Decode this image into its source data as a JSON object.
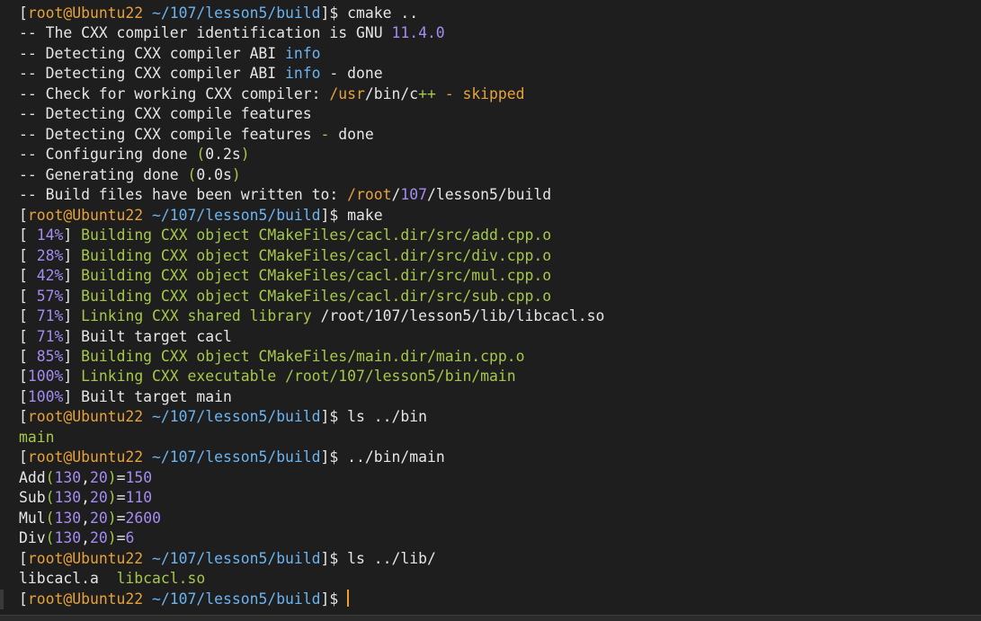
{
  "colors": {
    "background": "#1e1e1e",
    "default": "#e6e6e6",
    "orange": "#e8a23a",
    "purple": "#a58cf0",
    "blue": "#6cb4f0",
    "green": "#a6c84a",
    "bracket": "#e6e6e6"
  },
  "terminal": {
    "lines": [
      [
        [
          "[",
          "bracket"
        ],
        [
          "root@Ubuntu22",
          "orange"
        ],
        [
          " ~/107/lesson5/build",
          "blue"
        ],
        [
          "]$ cmake ..",
          "default"
        ]
      ],
      [
        [
          "-- The CXX compiler identification is GNU ",
          "default"
        ],
        [
          "11.4.0",
          "purple"
        ]
      ],
      [
        [
          "-- Detecting CXX compiler ABI ",
          "default"
        ],
        [
          "info",
          "blue"
        ]
      ],
      [
        [
          "-- Detecting CXX compiler ABI ",
          "default"
        ],
        [
          "info",
          "blue"
        ],
        [
          " - done",
          "default"
        ]
      ],
      [
        [
          "-- Check for working CXX compiler: ",
          "default"
        ],
        [
          "/usr",
          "orange"
        ],
        [
          "/bin/c",
          "default"
        ],
        [
          "++",
          "green"
        ],
        [
          " - skipped",
          "orange"
        ]
      ],
      [
        [
          "-- Detecting CXX compile features",
          "default"
        ]
      ],
      [
        [
          "-- Detecting CXX compile features ",
          "default"
        ],
        [
          "-",
          "green"
        ],
        [
          " done",
          "default"
        ]
      ],
      [
        [
          "-- Configuring done ",
          "default"
        ],
        [
          "(",
          "green"
        ],
        [
          "0.2s",
          "default"
        ],
        [
          ")",
          "green"
        ]
      ],
      [
        [
          "-- Generating done ",
          "default"
        ],
        [
          "(",
          "green"
        ],
        [
          "0.0s",
          "default"
        ],
        [
          ")",
          "green"
        ]
      ],
      [
        [
          "-- Build files have been written to: ",
          "default"
        ],
        [
          "/root",
          "orange"
        ],
        [
          "/",
          "default"
        ],
        [
          "107",
          "purple"
        ],
        [
          "/lesson5/build",
          "default"
        ]
      ],
      [
        [
          "[",
          "bracket"
        ],
        [
          "root@Ubuntu22",
          "orange"
        ],
        [
          " ~/107/lesson5/build",
          "blue"
        ],
        [
          "]$ make",
          "default"
        ]
      ],
      [
        [
          "[ ",
          "default"
        ],
        [
          "14%",
          "purple"
        ],
        [
          "] ",
          "default"
        ],
        [
          "Building CXX object CMakeFiles/cacl.dir/src/add.cpp.o",
          "green"
        ]
      ],
      [
        [
          "[ ",
          "default"
        ],
        [
          "28%",
          "purple"
        ],
        [
          "] ",
          "default"
        ],
        [
          "Building CXX object CMakeFiles/cacl.dir/src/div.cpp.o",
          "green"
        ]
      ],
      [
        [
          "[ ",
          "default"
        ],
        [
          "42%",
          "purple"
        ],
        [
          "] ",
          "default"
        ],
        [
          "Building CXX object CMakeFiles/cacl.dir/src/mul.cpp.o",
          "green"
        ]
      ],
      [
        [
          "[ ",
          "default"
        ],
        [
          "57%",
          "purple"
        ],
        [
          "] ",
          "default"
        ],
        [
          "Building CXX object CMakeFiles/cacl.dir/src/sub.cpp.o",
          "green"
        ]
      ],
      [
        [
          "[ ",
          "default"
        ],
        [
          "71%",
          "purple"
        ],
        [
          "] ",
          "default"
        ],
        [
          "Linking CXX shared library ",
          "green"
        ],
        [
          "/root/107/lesson5/lib/libcacl.so",
          "default"
        ]
      ],
      [
        [
          "[ ",
          "default"
        ],
        [
          "71%",
          "purple"
        ],
        [
          "] Built target cacl",
          "default"
        ]
      ],
      [
        [
          "[ ",
          "default"
        ],
        [
          "85%",
          "purple"
        ],
        [
          "] ",
          "default"
        ],
        [
          "Building CXX object CMakeFiles/main.dir/main.cpp.o",
          "green"
        ]
      ],
      [
        [
          "[",
          "default"
        ],
        [
          "100%",
          "purple"
        ],
        [
          "] ",
          "default"
        ],
        [
          "Linking CXX executable ",
          "green"
        ],
        [
          "/root/107/lesson5/bin/main",
          "green"
        ]
      ],
      [
        [
          "[",
          "default"
        ],
        [
          "100%",
          "purple"
        ],
        [
          "] Built target main",
          "default"
        ]
      ],
      [
        [
          "[",
          "bracket"
        ],
        [
          "root@Ubuntu22",
          "orange"
        ],
        [
          " ~/107/lesson5/build",
          "blue"
        ],
        [
          "]$ ls ../bin",
          "default"
        ]
      ],
      [
        [
          "main",
          "green"
        ]
      ],
      [
        [
          "[",
          "bracket"
        ],
        [
          "root@Ubuntu22",
          "orange"
        ],
        [
          " ~/107/lesson5/build",
          "blue"
        ],
        [
          "]$ ../bin/main",
          "default"
        ]
      ],
      [
        [
          "Add",
          "default"
        ],
        [
          "(",
          "green"
        ],
        [
          "130",
          "purple"
        ],
        [
          ",",
          "default"
        ],
        [
          "20",
          "purple"
        ],
        [
          ")",
          "green"
        ],
        [
          "=",
          "default"
        ],
        [
          "150",
          "purple"
        ]
      ],
      [
        [
          "Sub",
          "default"
        ],
        [
          "(",
          "green"
        ],
        [
          "130",
          "purple"
        ],
        [
          ",",
          "default"
        ],
        [
          "20",
          "purple"
        ],
        [
          ")",
          "green"
        ],
        [
          "=",
          "default"
        ],
        [
          "110",
          "purple"
        ]
      ],
      [
        [
          "Mul",
          "default"
        ],
        [
          "(",
          "green"
        ],
        [
          "130",
          "purple"
        ],
        [
          ",",
          "default"
        ],
        [
          "20",
          "purple"
        ],
        [
          ")",
          "green"
        ],
        [
          "=",
          "default"
        ],
        [
          "2600",
          "purple"
        ]
      ],
      [
        [
          "Div",
          "default"
        ],
        [
          "(",
          "green"
        ],
        [
          "130",
          "purple"
        ],
        [
          ",",
          "default"
        ],
        [
          "20",
          "purple"
        ],
        [
          ")",
          "green"
        ],
        [
          "=",
          "default"
        ],
        [
          "6",
          "purple"
        ]
      ],
      [
        [
          "[",
          "bracket"
        ],
        [
          "root@Ubuntu22",
          "orange"
        ],
        [
          " ~/107/lesson5/build",
          "blue"
        ],
        [
          "]$ ls ../lib/",
          "default"
        ]
      ],
      [
        [
          "libcacl.a  ",
          "default"
        ],
        [
          "libcacl.so",
          "green"
        ]
      ],
      [
        [
          "[",
          "bracket"
        ],
        [
          "root@Ubuntu22",
          "orange"
        ],
        [
          " ~/107/lesson5/build",
          "blue"
        ],
        [
          "]$ ",
          "default"
        ]
      ]
    ]
  }
}
